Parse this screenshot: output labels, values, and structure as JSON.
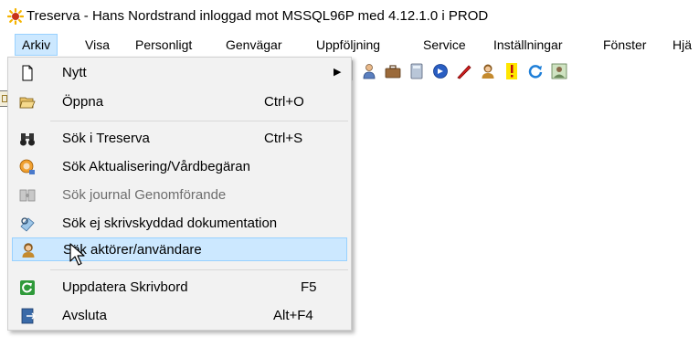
{
  "window": {
    "title": "Treserva - Hans Nordstrand inloggad mot MSSQL96P  med 4.12.1.0 i PROD"
  },
  "menubar": {
    "items": [
      {
        "label": "Arkiv"
      },
      {
        "label": "Visa"
      },
      {
        "label": "Personligt"
      },
      {
        "label": "Genvägar"
      },
      {
        "label": "Uppföljning"
      },
      {
        "label": "Service"
      },
      {
        "label": "Inställningar"
      },
      {
        "label": "Fönster"
      },
      {
        "label": "Hjä"
      }
    ]
  },
  "arkiv_menu": {
    "items": [
      {
        "label": "Nytt",
        "shortcut": "",
        "icon": "new-document-icon",
        "submenu": true
      },
      {
        "label": "Öppna",
        "shortcut": "Ctrl+O",
        "icon": "open-folder-icon"
      },
      {
        "label": "Sök i Treserva",
        "shortcut": "Ctrl+S",
        "icon": "binoculars-icon"
      },
      {
        "label": "Sök Aktualisering/Vårdbegäran",
        "shortcut": "",
        "icon": "search-request-icon"
      },
      {
        "label": "Sök journal Genomförande",
        "shortcut": "",
        "icon": "journal-search-icon",
        "disabled": true
      },
      {
        "label": "Sök ej skrivskyddad dokumentation",
        "shortcut": "",
        "icon": "document-search-icon"
      },
      {
        "label": "Sök aktörer/användare",
        "shortcut": "",
        "icon": "person-icon",
        "highlighted": true
      },
      {
        "label": "Uppdatera Skrivbord",
        "shortcut": "F5",
        "icon": "refresh-desktop-icon"
      },
      {
        "label": "Avsluta",
        "shortcut": "Alt+F4",
        "icon": "exit-door-icon"
      }
    ]
  },
  "toolbar": {
    "buttons": [
      "user-icon",
      "briefcase-icon",
      "calculator-icon",
      "blue-globe-icon",
      "red-pen-icon",
      "person-icon",
      "warning-icon",
      "refresh-icon",
      "image-icon"
    ]
  },
  "colors": {
    "highlight_bg": "#cce8ff",
    "highlight_border": "#99d1ff",
    "menu_bg": "#f2f2f2"
  }
}
